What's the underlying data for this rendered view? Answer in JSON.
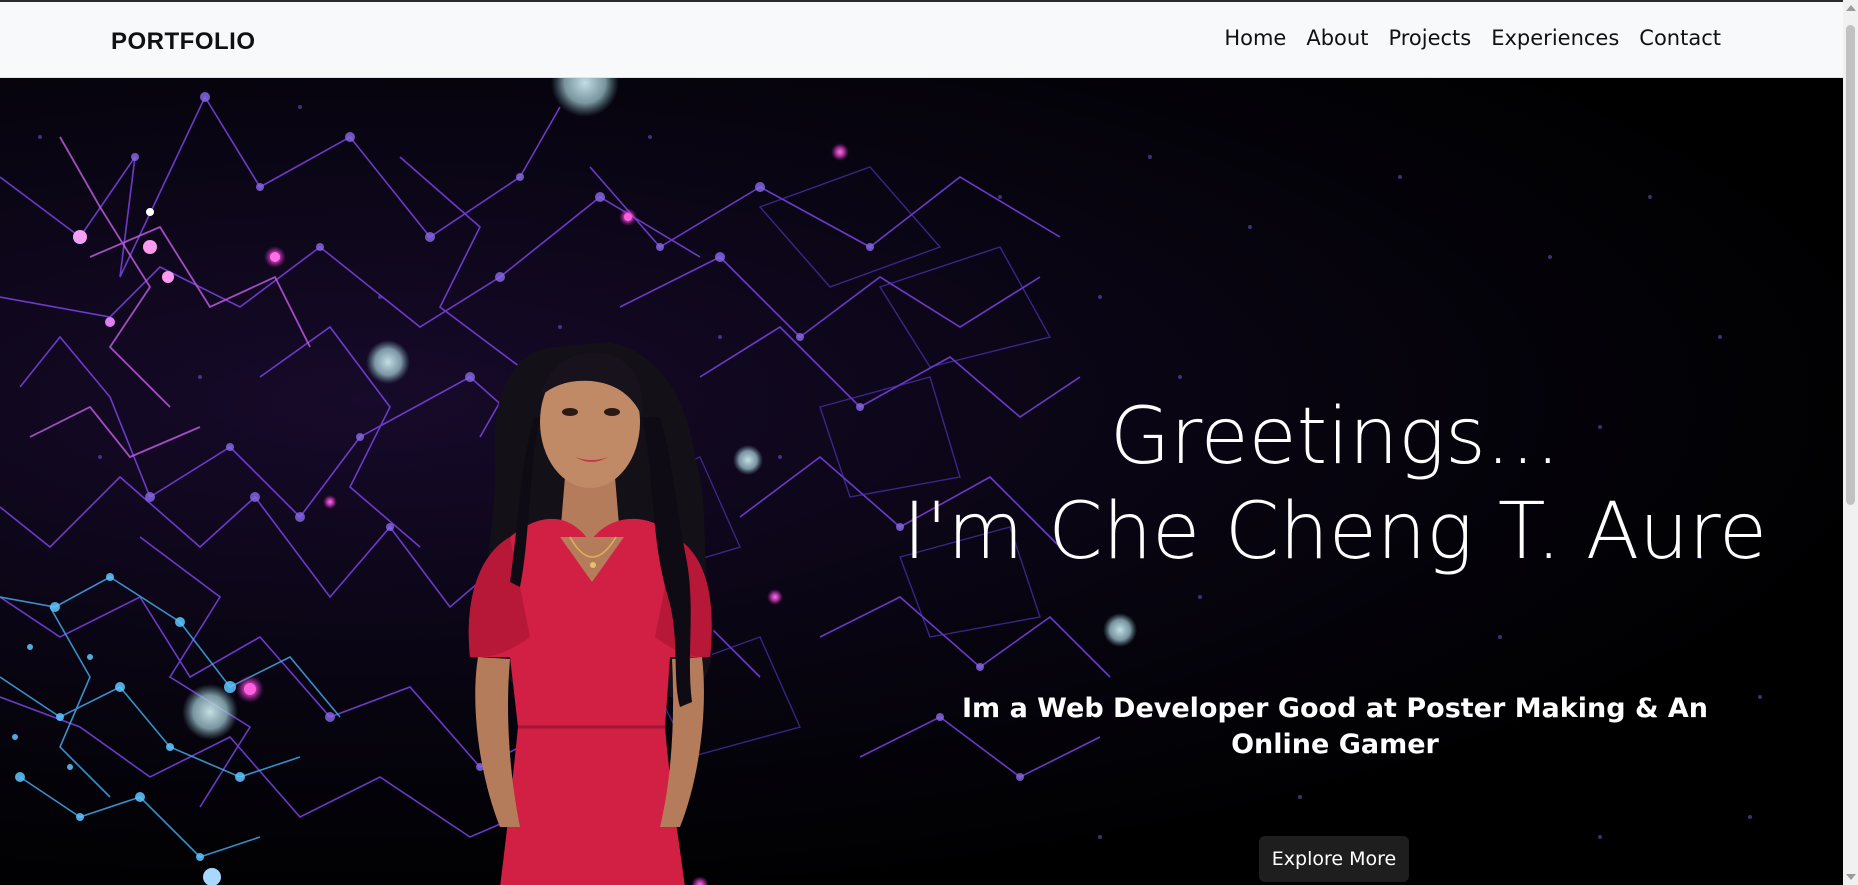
{
  "navbar": {
    "brand": "PORTFOLIO",
    "links": [
      "Home",
      "About",
      "Projects",
      "Experiences",
      "Contact"
    ]
  },
  "hero": {
    "greeting_line1": "Greetings...",
    "greeting_line2": "I'm Che Cheng T. Aure",
    "tagline": "Im a Web Developer Good at Poster Making & An Online Gamer",
    "cta_label": "Explore More",
    "background_icon": "constellation-network-background",
    "portrait_icon": "woman-in-red-dress-portrait"
  },
  "colors": {
    "navbar_bg": "#f8f9fa",
    "hero_bg": "#000000",
    "accent_purple": "#7b3fe0",
    "accent_magenta": "#e040c8",
    "accent_cyan": "#4fd8ff",
    "dress_red": "#d21f44",
    "button_bg": "#1e1e1e"
  }
}
